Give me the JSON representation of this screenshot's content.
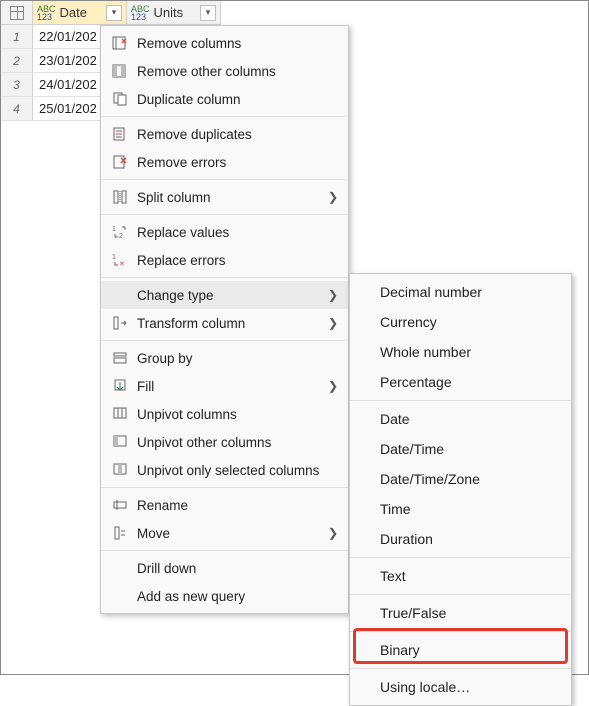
{
  "columns": [
    {
      "label": "Date",
      "active": true
    },
    {
      "label": "Units",
      "active": false
    }
  ],
  "rows": [
    {
      "num": "1",
      "date": "22/01/202"
    },
    {
      "num": "2",
      "date": "23/01/202"
    },
    {
      "num": "3",
      "date": "24/01/202"
    },
    {
      "num": "4",
      "date": "25/01/202"
    }
  ],
  "menu": {
    "remove_columns": "Remove columns",
    "remove_other_columns": "Remove other columns",
    "duplicate_column": "Duplicate column",
    "remove_duplicates": "Remove duplicates",
    "remove_errors": "Remove errors",
    "split_column": "Split column",
    "replace_values": "Replace values",
    "replace_errors": "Replace errors",
    "change_type": "Change type",
    "transform_column": "Transform column",
    "group_by": "Group by",
    "fill": "Fill",
    "unpivot_columns": "Unpivot columns",
    "unpivot_other_columns": "Unpivot other columns",
    "unpivot_only_selected_columns": "Unpivot only selected columns",
    "rename": "Rename",
    "move": "Move",
    "drill_down": "Drill down",
    "add_as_new_query": "Add as new query"
  },
  "submenu": {
    "decimal_number": "Decimal number",
    "currency": "Currency",
    "whole_number": "Whole number",
    "percentage": "Percentage",
    "date": "Date",
    "date_time": "Date/Time",
    "date_time_zone": "Date/Time/Zone",
    "time": "Time",
    "duration": "Duration",
    "text": "Text",
    "true_false": "True/False",
    "binary": "Binary",
    "using_locale": "Using locale…"
  }
}
